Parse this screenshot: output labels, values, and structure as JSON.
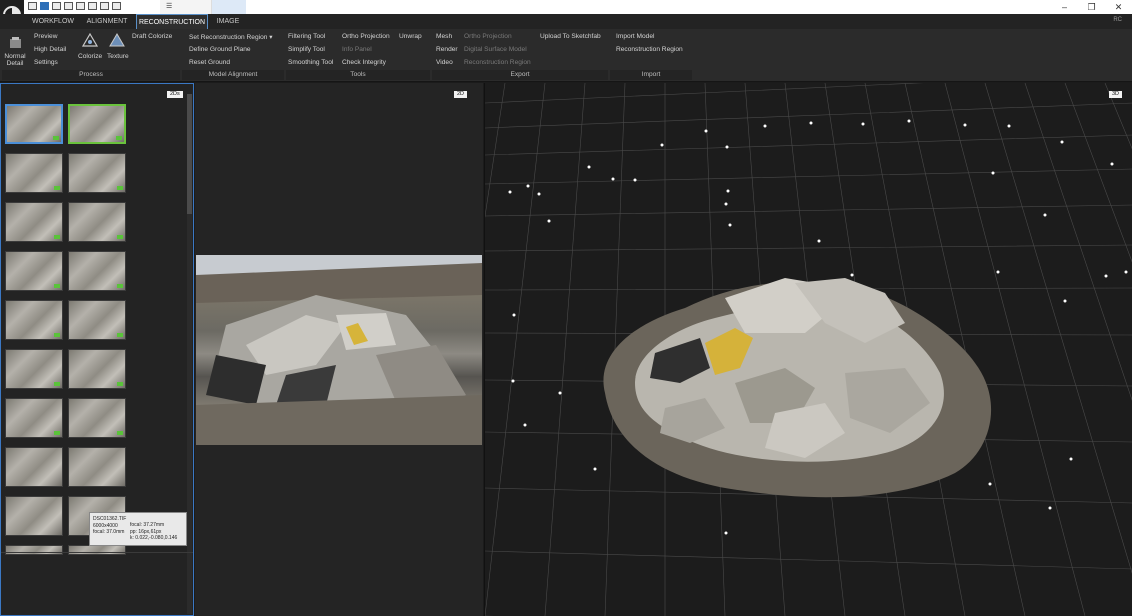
{
  "titlebar": {
    "tab_label": "☰"
  },
  "ribbon_tabs": [
    {
      "label": "WORKFLOW"
    },
    {
      "label": "ALIGNMENT"
    },
    {
      "label": "RECONSTRUCTION"
    },
    {
      "label": "IMAGE"
    }
  ],
  "user_initials": "RC",
  "process": {
    "normal_detail_line1": "Normal",
    "normal_detail_line2": "Detail",
    "preview": "Preview",
    "high_detail": "High Detail",
    "settings": "Settings",
    "colorize": "Colorize",
    "texture": "Texture",
    "draft_colorize": "Draft Colorize",
    "group": "Process"
  },
  "model_alignment": {
    "set_region": "Set Reconstruction Region",
    "define_ground": "Define Ground Plane",
    "reset_ground": "Reset Ground",
    "group": "Model Alignment"
  },
  "tools": {
    "filtering": "Filtering Tool",
    "simplify": "Simplify Tool",
    "smoothing": "Smoothing Tool",
    "ortho": "Ortho Projection",
    "unwrap": "Unwrap",
    "info_panel": "Info Panel",
    "check_integrity": "Check Integrity",
    "group": "Tools"
  },
  "export": {
    "mesh": "Mesh",
    "render": "Render",
    "video": "Video",
    "ortho": "Ortho Projection",
    "dsm": "Digital Surface Model",
    "recon_region": "Reconstruction Region",
    "sketchfab": "Upload To Sketchfab",
    "group": "Export"
  },
  "import": {
    "import_model": "Import Model",
    "recon_region": "Reconstruction Region",
    "group": "Import"
  },
  "views": {
    "left_badge": "2Ds",
    "mid_badge": "2D",
    "right_badge": "3D"
  },
  "tooltip": {
    "filename": "DSC01362.TIF",
    "resolution": "6000x4000",
    "focal_left": "focal: 37.0mm",
    "focal_right": "focal: 37.27mm",
    "pp": "pp: 16px,61px",
    "k": "k: 0.022,-0.080,0.146"
  }
}
